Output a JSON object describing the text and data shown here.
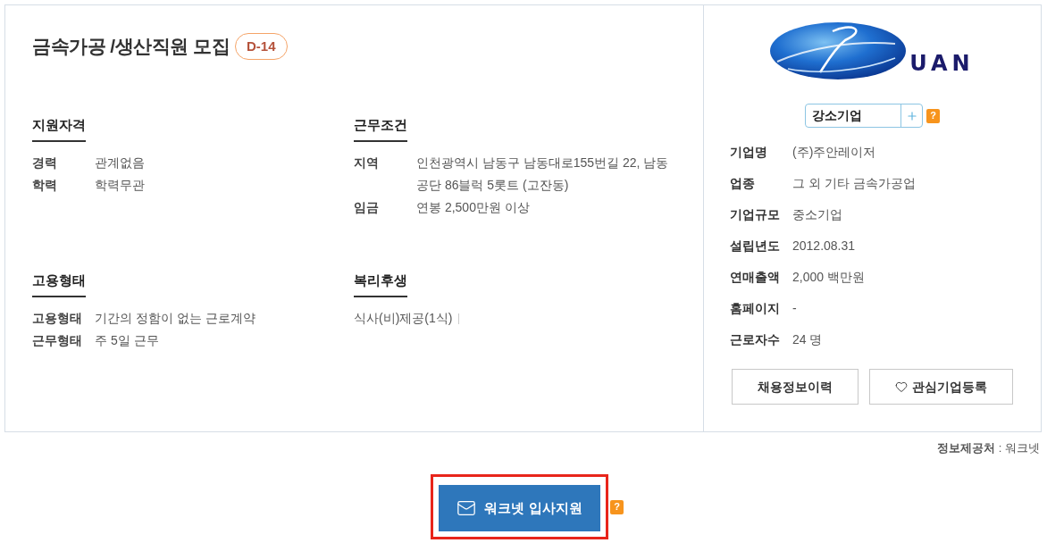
{
  "posting": {
    "title": "금속가공 /생산직원 모집",
    "dday": "D-14"
  },
  "sections": [
    {
      "kind": "rows",
      "heading": "지원자격",
      "rows": [
        {
          "label": "경력",
          "value": "관계없음"
        },
        {
          "label": "학력",
          "value": "학력무관"
        }
      ]
    },
    {
      "kind": "rows",
      "heading": "근무조건",
      "rows": [
        {
          "label": "지역",
          "value": "인천광역시 남동구 남동대로155번길 22, 남동공단 86블럭 5롯트 (고잔동)"
        },
        {
          "label": "임금",
          "value": "연봉 2,500만원 이상"
        }
      ]
    },
    {
      "kind": "rows",
      "heading": "고용형태",
      "rows": [
        {
          "label": "고용형태",
          "value": "기간의 정함이 없는 근로계약"
        },
        {
          "label": "근무형태",
          "value": "주 5일 근무"
        }
      ]
    },
    {
      "kind": "list",
      "heading": "복리후생",
      "items": [
        "식사(비)제공(1식)"
      ]
    }
  ],
  "company": {
    "logo_text": "UAN",
    "tag": "강소기업",
    "tag_help": "?",
    "info": [
      {
        "label": "기업명",
        "value": "(주)주안레이저"
      },
      {
        "label": "업종",
        "value": "그 외 기타 금속가공업"
      },
      {
        "label": "기업규모",
        "value": "중소기업"
      },
      {
        "label": "설립년도",
        "value": "2012.08.31"
      },
      {
        "label": "연매출액",
        "value": "2,000 백만원"
      },
      {
        "label": "홈페이지",
        "value": "-"
      },
      {
        "label": "근로자수",
        "value": "24 명"
      }
    ],
    "buttons": [
      {
        "kind": "plain",
        "label": "채용정보이력"
      },
      {
        "kind": "favorite",
        "label": "관심기업등록"
      }
    ]
  },
  "source": "**정보제공처** : 워크넷",
  "apply": {
    "label": "워크넷 입사지원",
    "highlighted": true,
    "help": "?"
  }
}
